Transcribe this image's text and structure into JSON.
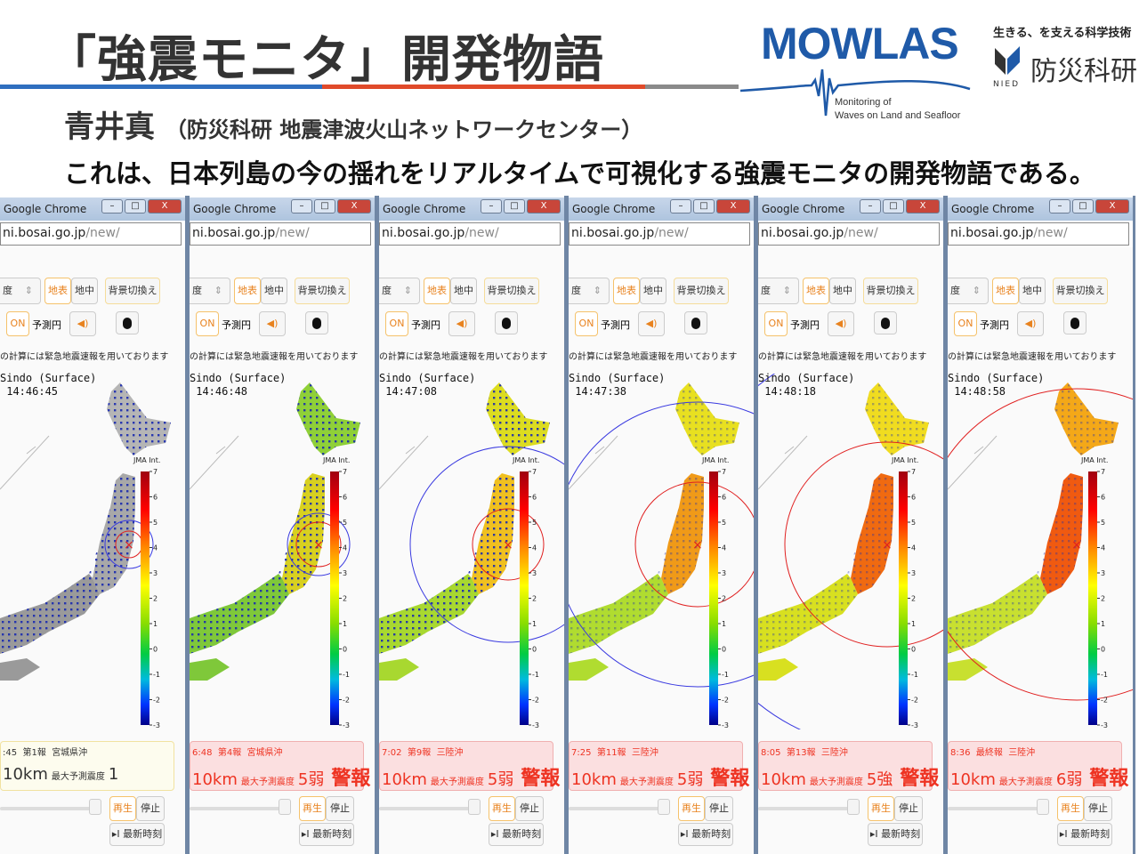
{
  "slide": {
    "title": "「強震モニタ」開発物語",
    "author": "青井真",
    "affiliation": "（防災科研 地震津波火山ネットワークセンター）",
    "lead": "これは、日本列島の今の揺れをリアルタイムで可視化する強震モニタの開発物語である。",
    "rule_colors": [
      "#2f6fbf",
      "#e04a2a",
      "#8a8a8a"
    ]
  },
  "logos": {
    "mowlas": "MOWLAS",
    "mowlas_sub1": "Monitoring of",
    "mowlas_sub2": "Waves on Land and Seafloor",
    "nied_tagline": "生きる、を支える科学技術",
    "nied_name": "防災科研",
    "nied_en": "NIED"
  },
  "browser": {
    "window_title": "Google Chrome",
    "url_host": "ni.bosai.go.jp",
    "url_path": "/new/",
    "minimize": "–",
    "maximize": "□",
    "close": "X"
  },
  "controls": {
    "select_value": "度",
    "surface": "地表",
    "underground": "地中",
    "bg_switch": "背景切換え",
    "on": "ON",
    "forecast_circle": "予測円",
    "sound_icon": "speaker-icon",
    "info_icon": "info-icon",
    "notice": "の計算には緊急地震速報を用いております",
    "shindo_label": "Sindo (Surface)",
    "scale_label": "JMA Int.",
    "scale_ticks": [
      "7",
      "6",
      "5",
      "4",
      "3",
      "2",
      "1",
      "0",
      "-1",
      "-2",
      "-3"
    ],
    "max_intensity_label": "最大予測震度",
    "play": "再生",
    "stop": "停止",
    "latest": "▸I 最新時刻"
  },
  "panels": [
    {
      "time": "14:46:45",
      "report_time": ":45",
      "report": "第1報",
      "region": "宮城県沖",
      "depth": "10km",
      "intensity": "1",
      "alert": "",
      "north_color": "#b5b5b5",
      "tohoku_color": "#a8a8a8",
      "west_color": "#9a9a9a"
    },
    {
      "time": "14:46:48",
      "report_time": "6:48",
      "report": "第4報",
      "region": "宮城県沖",
      "depth": "10km",
      "intensity": "5弱",
      "alert": "警報",
      "north_color": "#8fd038",
      "tohoku_color": "#d8d020",
      "west_color": "#7fc83a"
    },
    {
      "time": "14:47:08",
      "report_time": "7:02",
      "report": "第9報",
      "region": "三陸沖",
      "depth": "10km",
      "intensity": "5弱",
      "alert": "警報",
      "north_color": "#dcdc20",
      "tohoku_color": "#f0c020",
      "west_color": "#a8d830"
    },
    {
      "time": "14:47:38",
      "report_time": "7:25",
      "report": "第11報",
      "region": "三陸沖",
      "depth": "10km",
      "intensity": "5弱",
      "alert": "警報",
      "north_color": "#e8e020",
      "tohoku_color": "#f09a18",
      "west_color": "#b0dc30"
    },
    {
      "time": "14:48:18",
      "report_time": "8:05",
      "report": "第13報",
      "region": "三陸沖",
      "depth": "10km",
      "intensity": "5強",
      "alert": "警報",
      "north_color": "#f0dc20",
      "tohoku_color": "#f06a10",
      "west_color": "#d8e020"
    },
    {
      "time": "14:48:58",
      "report_time": "8:36",
      "report": "最終報",
      "region": "三陸沖",
      "depth": "10km",
      "intensity": "6弱",
      "alert": "警報",
      "north_color": "#f4a818",
      "tohoku_color": "#f05a10",
      "west_color": "#c8e030"
    }
  ]
}
